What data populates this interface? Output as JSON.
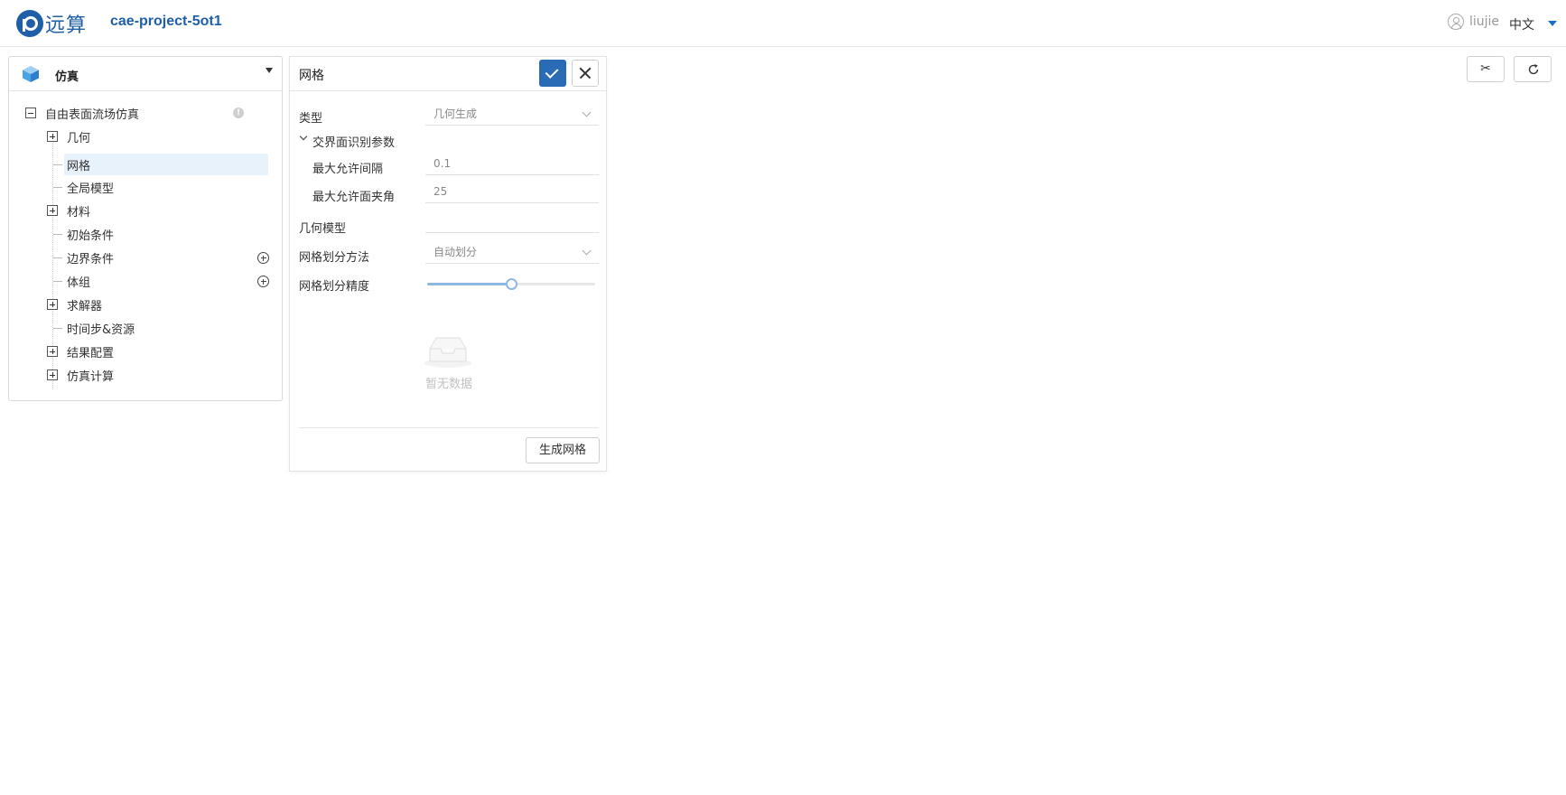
{
  "header": {
    "logo_text": "远算",
    "project_name": "cae-project-5ot1",
    "username": "liujie",
    "language": "中文"
  },
  "left_panel": {
    "title": "仿真",
    "tree": {
      "root": "自由表面流场仿真",
      "items": [
        {
          "label": "几何",
          "type": "expandable"
        },
        {
          "label": "网格",
          "type": "leaf",
          "selected": true
        },
        {
          "label": "全局模型",
          "type": "leaf"
        },
        {
          "label": "材料",
          "type": "expandable"
        },
        {
          "label": "初始条件",
          "type": "leaf"
        },
        {
          "label": "边界条件",
          "type": "leaf",
          "addable": true
        },
        {
          "label": "体组",
          "type": "leaf",
          "addable": true
        },
        {
          "label": "求解器",
          "type": "expandable"
        },
        {
          "label": "时间步&资源",
          "type": "leaf"
        },
        {
          "label": "结果配置",
          "type": "expandable"
        },
        {
          "label": "仿真计算",
          "type": "expandable"
        }
      ]
    }
  },
  "mesh_panel": {
    "title": "网格",
    "type_label": "类型",
    "type_value": "几何生成",
    "section_label": "交界面识别参数",
    "max_gap_label": "最大允许间隔",
    "max_gap_value": "0.1",
    "max_angle_label": "最大允许面夹角",
    "max_angle_value": "25",
    "geometry_model_label": "几何模型",
    "method_label": "网格划分方法",
    "method_value": "自动划分",
    "precision_label": "网格划分精度",
    "precision_value": 0.5,
    "empty_text": "暂无数据",
    "generate_button": "生成网格"
  },
  "toolbar": {
    "cut_icon": "scissors-icon",
    "refresh_icon": "refresh-icon"
  },
  "colors": {
    "brand": "#1f5fa8",
    "primary_button": "#2a6bb5",
    "slider": "#8cb8e0",
    "selected_row": "#e8f2fb"
  }
}
